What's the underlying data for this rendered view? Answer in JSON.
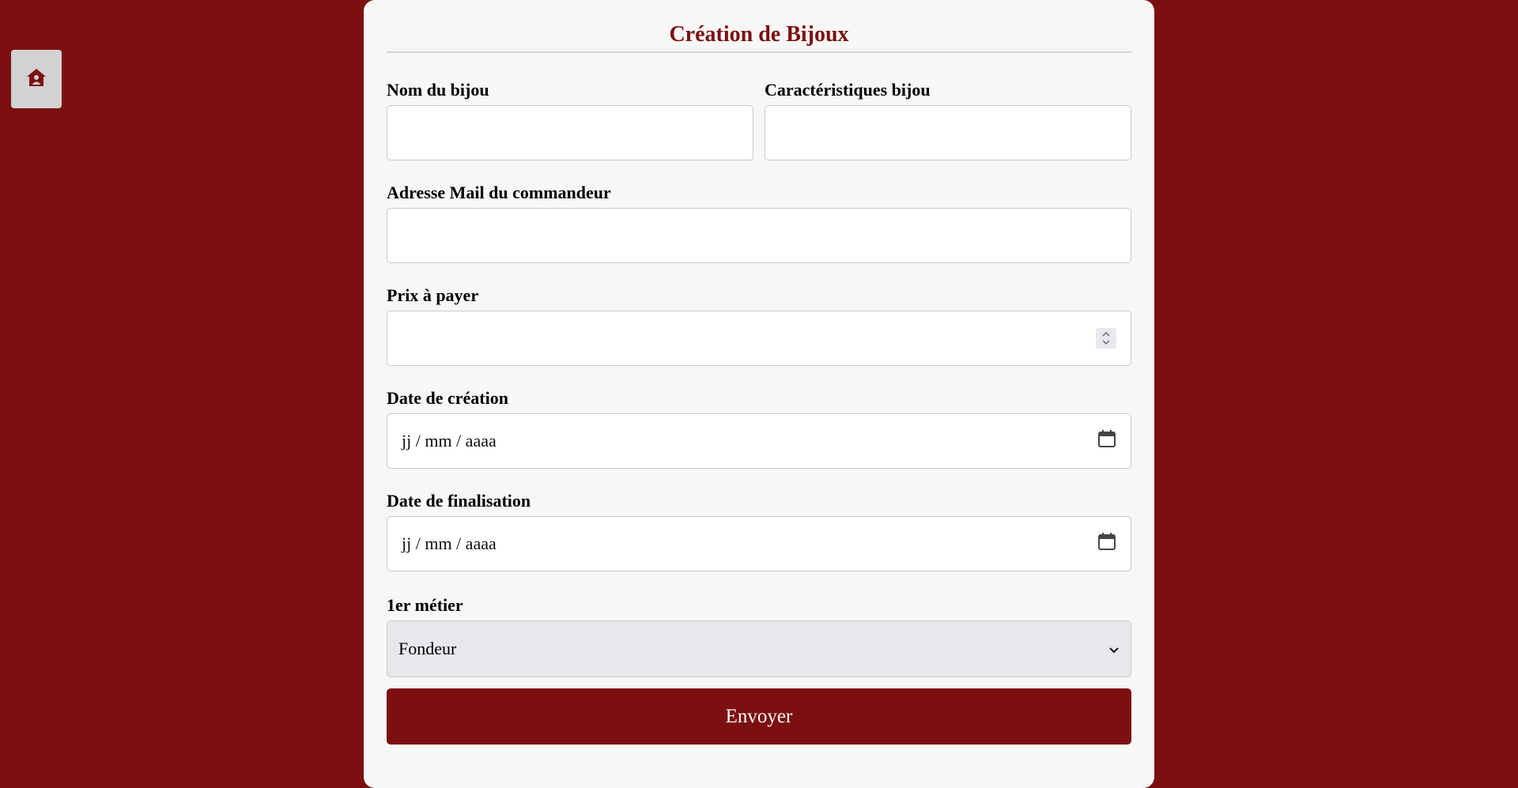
{
  "colors": {
    "background": "#7c1011",
    "card": "#f7f7f7",
    "accent": "#7c1011",
    "home_button": "#d2d2d2"
  },
  "home": {
    "icon": "house-icon"
  },
  "form": {
    "title": "Création de Bijoux",
    "fields": {
      "nom": {
        "label": "Nom du bijou",
        "value": ""
      },
      "caracteristiques": {
        "label": "Caractéristiques bijou",
        "value": ""
      },
      "email": {
        "label": "Adresse Mail du commandeur",
        "value": ""
      },
      "prix": {
        "label": "Prix à payer",
        "value": ""
      },
      "date_creation": {
        "label": "Date de création",
        "placeholder": "jj / mm / aaaa"
      },
      "date_finalisation": {
        "label": "Date de finalisation",
        "placeholder": "jj / mm / aaaa"
      },
      "metier": {
        "label": "1er métier",
        "selected": "Fondeur"
      }
    },
    "submit_label": "Envoyer"
  }
}
